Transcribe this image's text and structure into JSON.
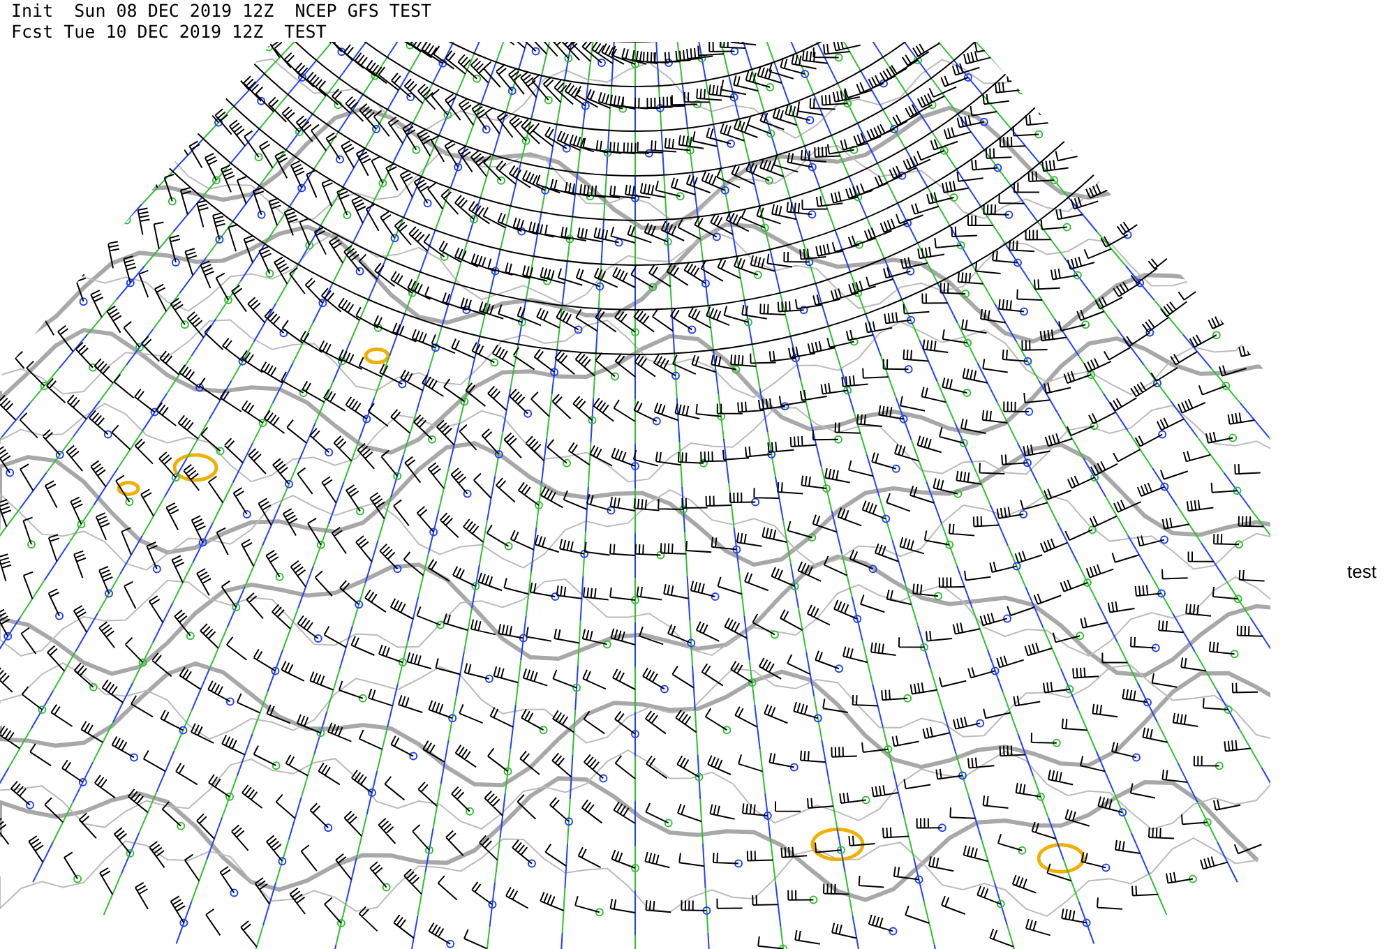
{
  "header": {
    "init_line": "Init  Sun 08 DEC 2019 12Z  NCEP GFS TEST",
    "forecast_line": "Fcst Tue 10 DEC 2019 12Z  TEST"
  },
  "side_label": "test"
}
